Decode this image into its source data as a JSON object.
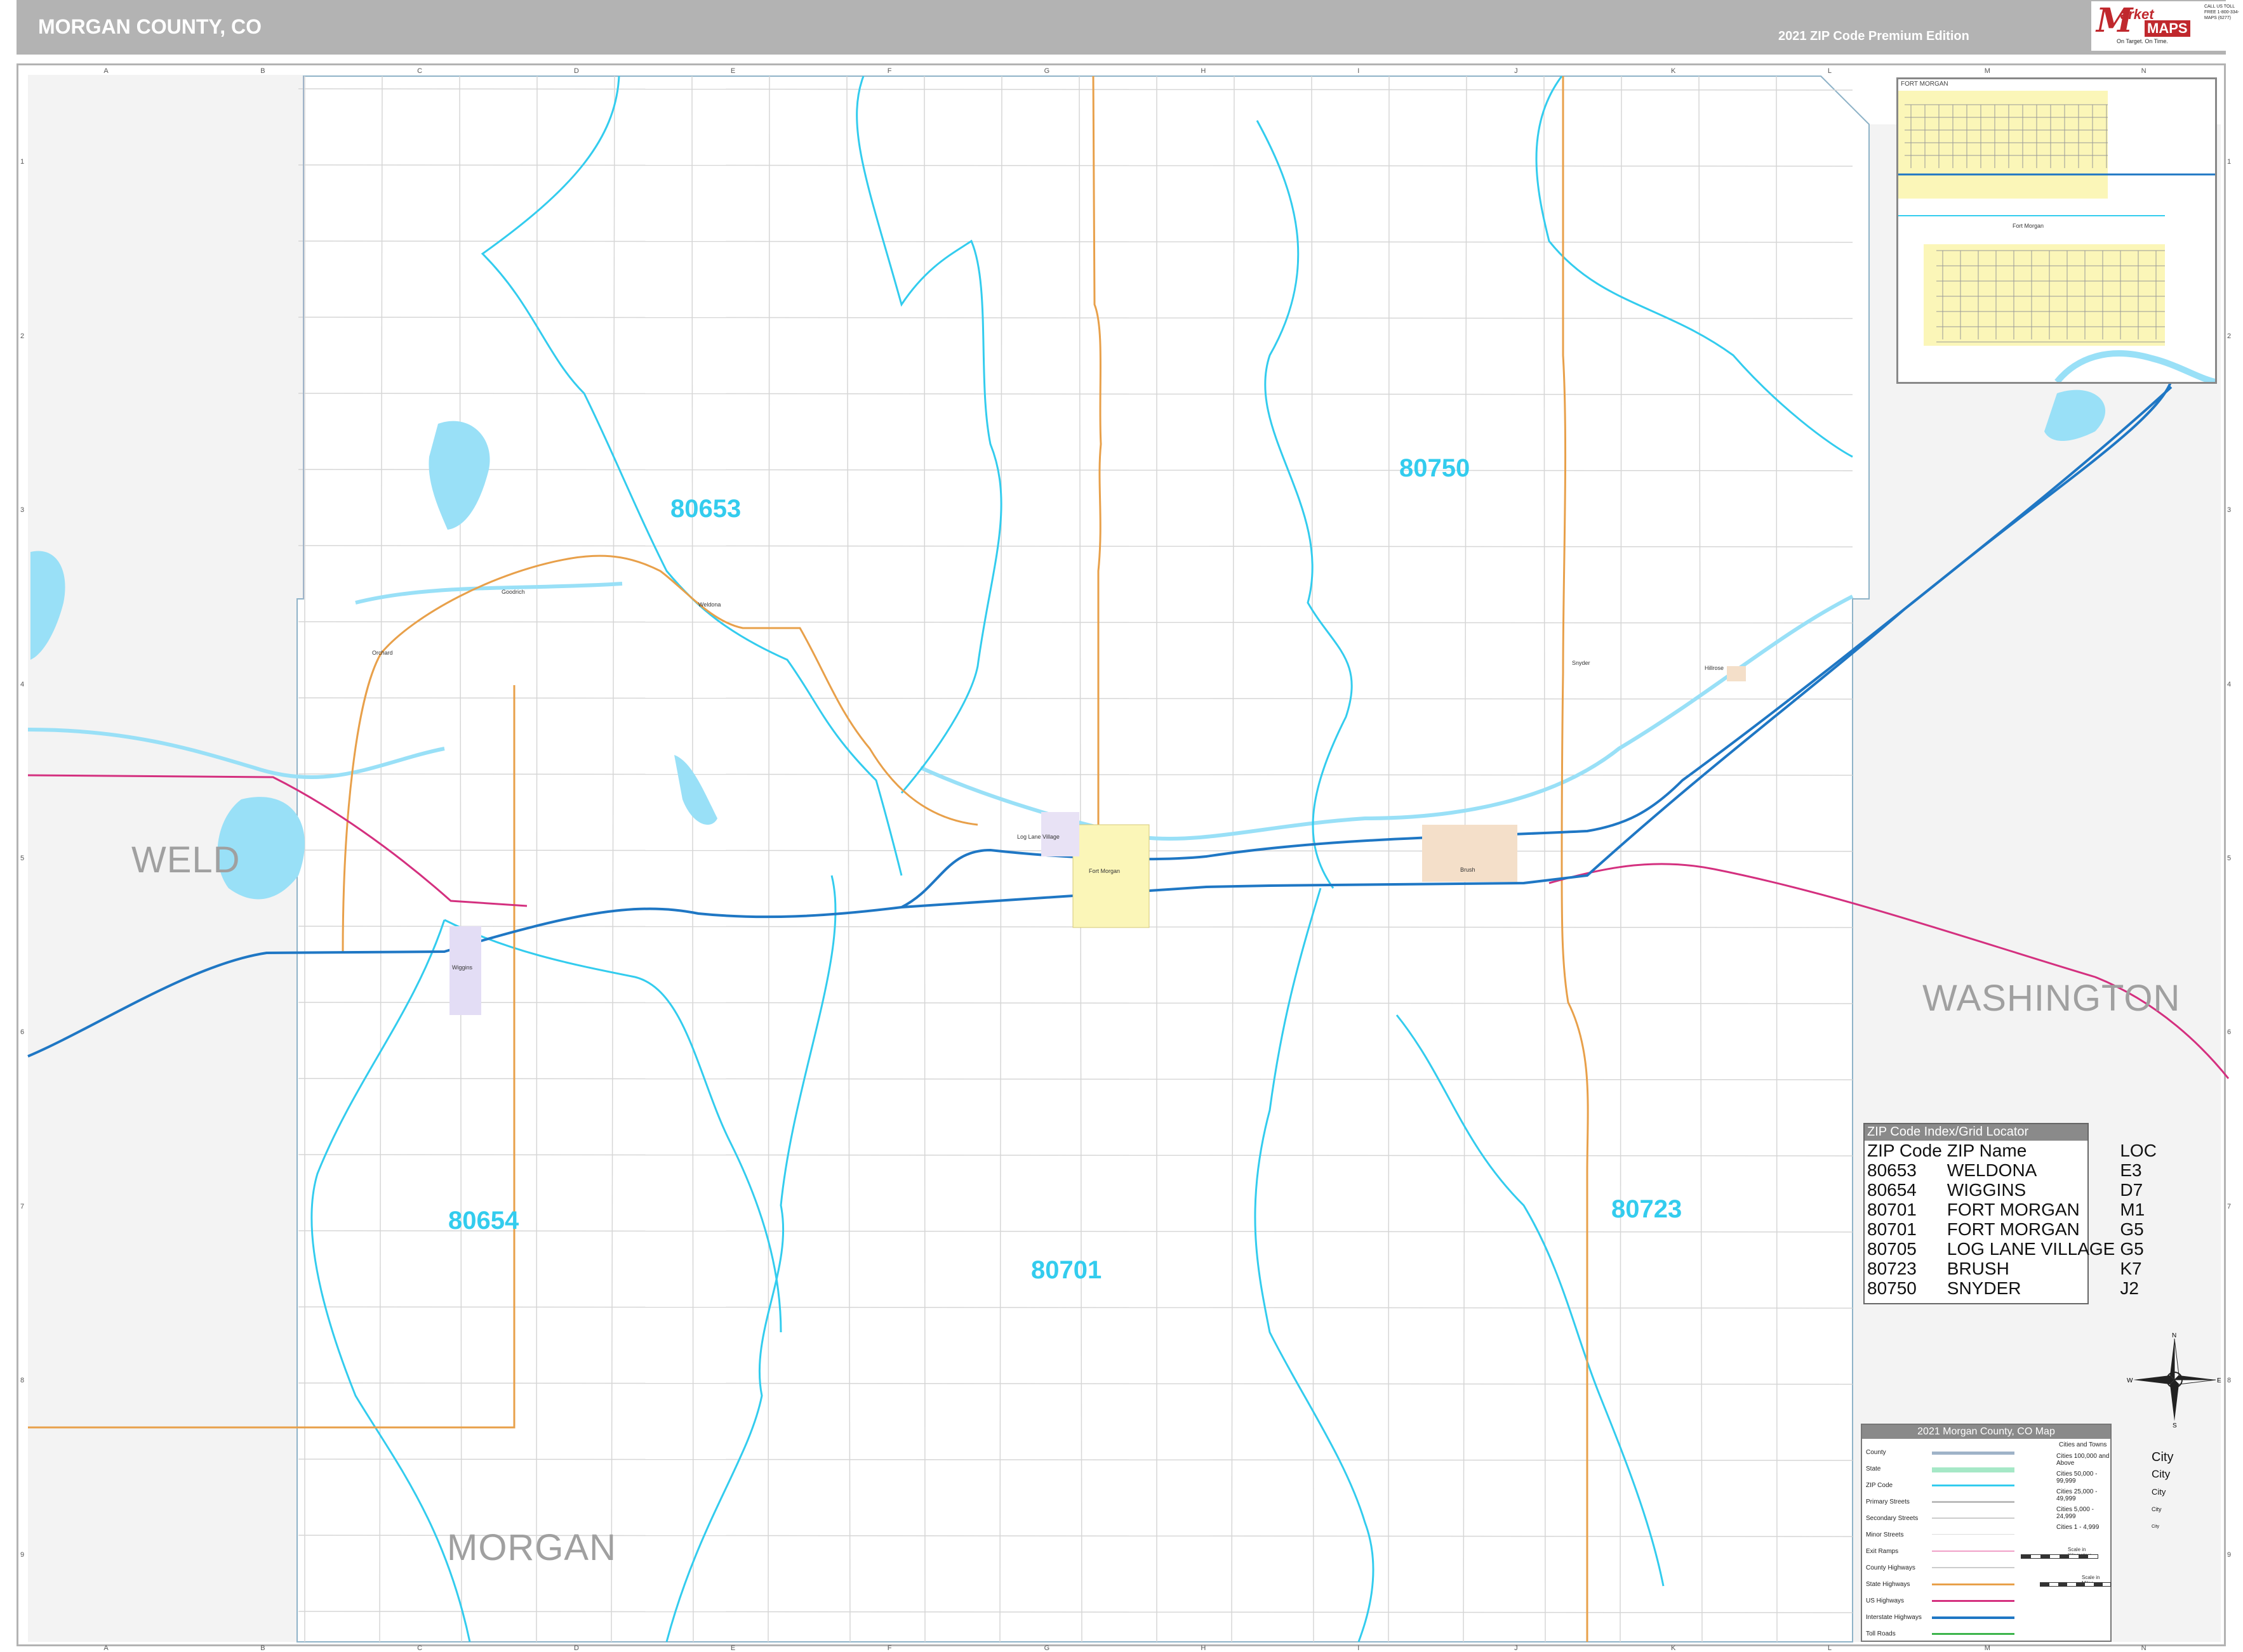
{
  "header": {
    "title": "MORGAN COUNTY, CO",
    "edition": "2021 ZIP Code Premium Edition",
    "logo": {
      "mark": "M",
      "brand": "arket",
      "maps": "MAPS",
      "tagline": "On Target. On Time.",
      "phone": "CALL US TOLL FREE 1-800-334-MAPS (6277)"
    }
  },
  "grid": {
    "columns": [
      "A",
      "B",
      "C",
      "D",
      "E",
      "F",
      "G",
      "H",
      "I",
      "J",
      "K",
      "L",
      "M",
      "N"
    ],
    "rows": [
      "1",
      "2",
      "3",
      "4",
      "5",
      "6",
      "7",
      "8",
      "9"
    ]
  },
  "counties": {
    "weld": "WELD",
    "washington": "WASHINGTON",
    "morgan": "MORGAN"
  },
  "zip_labels": {
    "z80653": "80653",
    "z80750": "80750",
    "z80654": "80654",
    "z80701": "80701",
    "z80723": "80723"
  },
  "towns": {
    "fort_morgan": "Fort Morgan",
    "brush": "Brush",
    "wiggins": "Wiggins",
    "weldona": "Weldona",
    "snyder": "Snyder",
    "log_lane": "Log Lane Village",
    "orchard": "Orchard",
    "goodrich": "Goodrich",
    "hillrose": "Hillrose"
  },
  "inset": {
    "title": "FORT MORGAN",
    "city": "Fort Morgan"
  },
  "zip_index": {
    "title": "ZIP Code Index/Grid Locator",
    "headers": [
      "ZIP Code",
      "ZIP Name",
      "LOC"
    ],
    "rows": [
      [
        "80653",
        "WELDONA",
        "E3"
      ],
      [
        "80654",
        "WIGGINS",
        "D7"
      ],
      [
        "80701",
        "FORT MORGAN",
        "M1"
      ],
      [
        "80701",
        "FORT MORGAN",
        "G5"
      ],
      [
        "80705",
        "LOG LANE VILLAGE",
        "G5"
      ],
      [
        "80723",
        "BRUSH",
        "K7"
      ],
      [
        "80750",
        "SNYDER",
        "J2"
      ]
    ]
  },
  "legend": {
    "title": "2021 Morgan County, CO Map",
    "items": [
      "County",
      "State",
      "ZIP Code",
      "Primary Streets",
      "Secondary Streets",
      "Minor Streets",
      "Exit Ramps",
      "County Highways",
      "State Highways",
      "US Highways",
      "Interstate Highways",
      "Toll Roads"
    ],
    "cities_title": "Cities and Towns",
    "cities": [
      {
        "range": "Cities 100,000 and Above",
        "sample": "City"
      },
      {
        "range": "Cities 50,000 - 99,999",
        "sample": "City"
      },
      {
        "range": "Cities 25,000 - 49,999",
        "sample": "City"
      },
      {
        "range": "Cities 5,000 - 24,999",
        "sample": "City"
      },
      {
        "range": "Cities 1 - 4,999",
        "sample": "City"
      }
    ],
    "scale_km": "Scale in Kilometers",
    "scale_mi": "Scale in Miles"
  },
  "compass": {
    "n": "N",
    "s": "S",
    "e": "E",
    "w": "W"
  },
  "colors": {
    "zip_boundary": "#33ccee",
    "interstate": "#1f77c4",
    "us_highway": "#d4307f",
    "state_highway": "#e8a04a",
    "water": "#99e0f7",
    "county_outside": "#f2f2f2",
    "county_line": "#9fb3c8"
  }
}
